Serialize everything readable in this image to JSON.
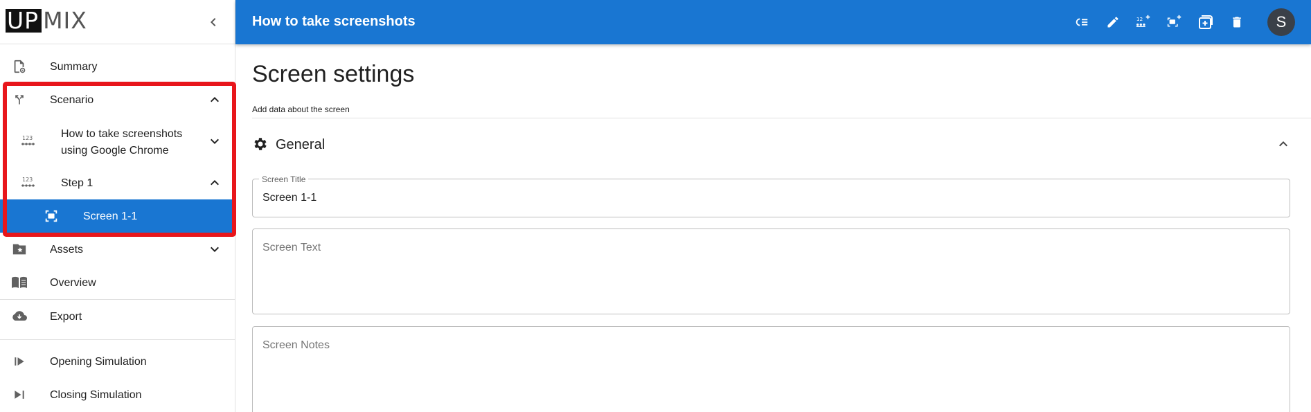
{
  "logo": {
    "part1": "UP",
    "part2": "MIX"
  },
  "sidebar": {
    "collapse_icon": "chevron-left-icon",
    "items": [
      {
        "label": "Summary",
        "icon": "document-settings-icon"
      },
      {
        "label": "Scenario",
        "icon": "fork-icon",
        "expanded": true
      },
      {
        "label": "How to take screenshots using Google Chrome",
        "line1": "How to take screenshots",
        "line2": "using Google Chrome",
        "icon": "numbered-list-icon",
        "expanded": false
      },
      {
        "label": "Step 1",
        "icon": "numbered-list-icon",
        "expanded": true
      },
      {
        "label": "Screen 1-1",
        "icon": "screenshot-icon",
        "selected": true
      },
      {
        "label": "Assets",
        "icon": "star-folder-icon",
        "expanded": false
      },
      {
        "label": "Overview",
        "icon": "book-icon"
      },
      {
        "label": "Export",
        "icon": "cloud-download-icon"
      },
      {
        "label": "Opening Simulation",
        "icon": "skip-start-icon"
      },
      {
        "label": "Closing Simulation",
        "icon": "skip-end-icon"
      }
    ]
  },
  "header": {
    "title": "How to take screenshots",
    "actions": [
      "list-icon",
      "edit-icon",
      "add-step-icon",
      "add-screen-icon",
      "add-copy-icon",
      "delete-icon"
    ],
    "avatar_letter": "S"
  },
  "main": {
    "page_title": "Screen settings",
    "subtitle": "Add data about the screen",
    "section": {
      "label": "General",
      "icon": "gear-icon"
    },
    "fields": {
      "screen_title": {
        "label": "Screen Title",
        "value": "Screen 1-1"
      },
      "screen_text": {
        "placeholder": "Screen Text"
      },
      "screen_notes": {
        "placeholder": "Screen Notes"
      }
    }
  },
  "colors": {
    "primary": "#1976d2",
    "highlight": "#e8161b",
    "avatar": "#3a4048"
  }
}
